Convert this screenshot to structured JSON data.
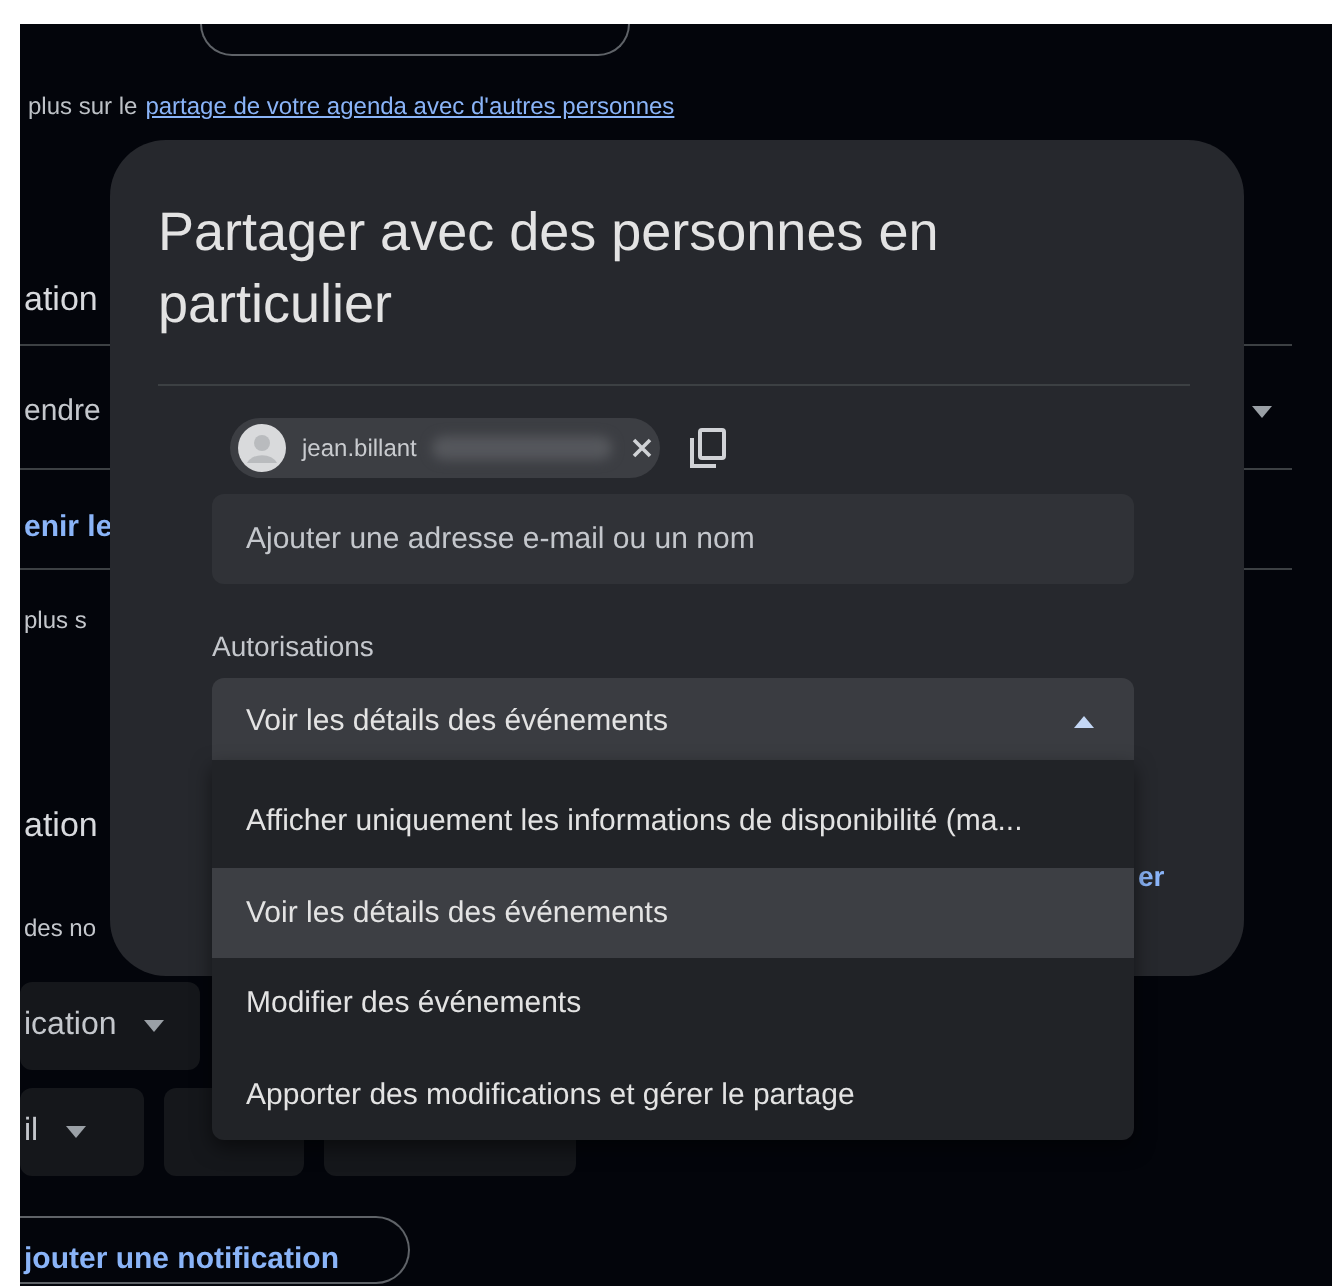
{
  "background_page": {
    "info": {
      "text": "plus sur le",
      "link": "partage de votre agenda avec d'autres personnes"
    },
    "section_1_title": "ation",
    "row_label": "endre",
    "row_link": "enir le",
    "row_text": "plus s",
    "section_2_title": "ation",
    "section_2_text": "des no",
    "notification": {
      "type": "ication",
      "method": "il"
    },
    "add_notification": "jouter une notification"
  },
  "dialog": {
    "title": "Partager avec des personnes en particulier",
    "guests": [
      {
        "name": "jean.billant"
      }
    ],
    "input": {
      "placeholder": "Ajouter une adresse e-mail ou un nom"
    },
    "permissions_label": "Autorisations",
    "permissions_select": {
      "value": "Voir les détails des événements",
      "expanded": true
    },
    "button_fragment": "er",
    "options": [
      {
        "label": "Afficher uniquement les informations de disponibilité (ma...",
        "selected": false
      },
      {
        "label": "Voir les détails des événements",
        "selected": true
      },
      {
        "label": "Modifier des événements",
        "selected": false
      },
      {
        "label": "Apporter des modifications et gérer le partage",
        "selected": false
      }
    ]
  }
}
